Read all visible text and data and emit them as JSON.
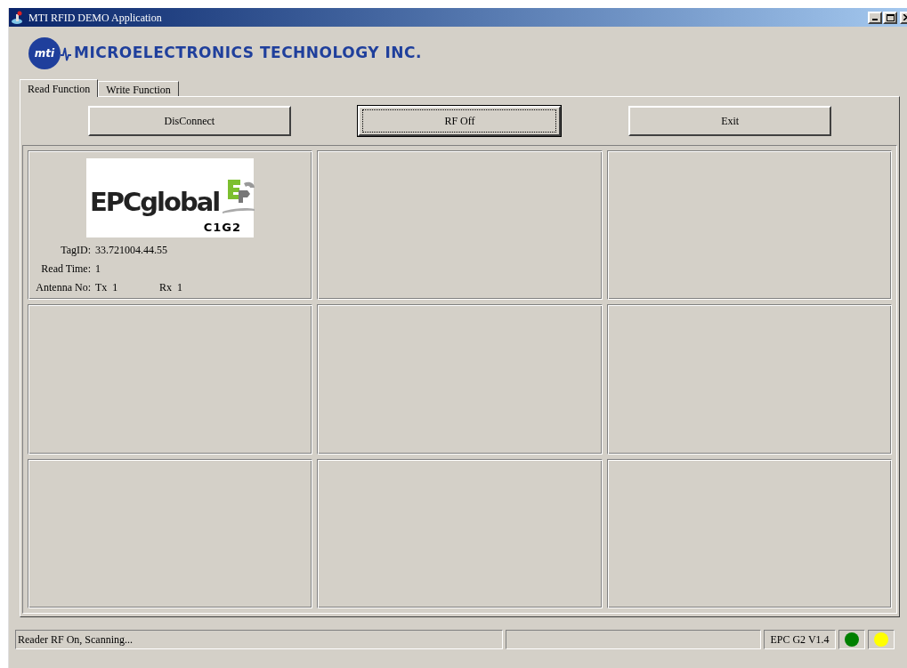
{
  "window": {
    "title": "MTI RFID DEMO Application"
  },
  "logo": {
    "mark": "mti",
    "company": "MICROELECTRONICS TECHNOLOGY INC."
  },
  "tabs": [
    {
      "label": "Read Function",
      "selected": true
    },
    {
      "label": "Write Function",
      "selected": false
    }
  ],
  "buttons": [
    {
      "label": "DisConnect",
      "focused": false
    },
    {
      "label": "RF Off",
      "focused": true
    },
    {
      "label": "Exit",
      "focused": false
    }
  ],
  "tag_cells": [
    {
      "kind": "tag",
      "logo_text": "EPCglobal",
      "logo_class": "C1G2",
      "fields": [
        {
          "label": "TagID:",
          "value": "33.721004.44.55"
        },
        {
          "label": "Read Time:",
          "value": "1"
        }
      ],
      "antenna": {
        "label": "Antenna No:",
        "tx": "Tx  1",
        "rx": "Rx  1"
      }
    },
    {
      "kind": "empty"
    },
    {
      "kind": "empty"
    },
    {
      "kind": "empty"
    },
    {
      "kind": "empty"
    },
    {
      "kind": "empty"
    },
    {
      "kind": "empty"
    },
    {
      "kind": "empty"
    },
    {
      "kind": "empty"
    }
  ],
  "status_bar": {
    "message": "Reader RF On, Scanning...",
    "version": "EPC G2 V1.4",
    "indicators": [
      {
        "color": "#008000"
      },
      {
        "color": "#ffff00"
      }
    ]
  }
}
